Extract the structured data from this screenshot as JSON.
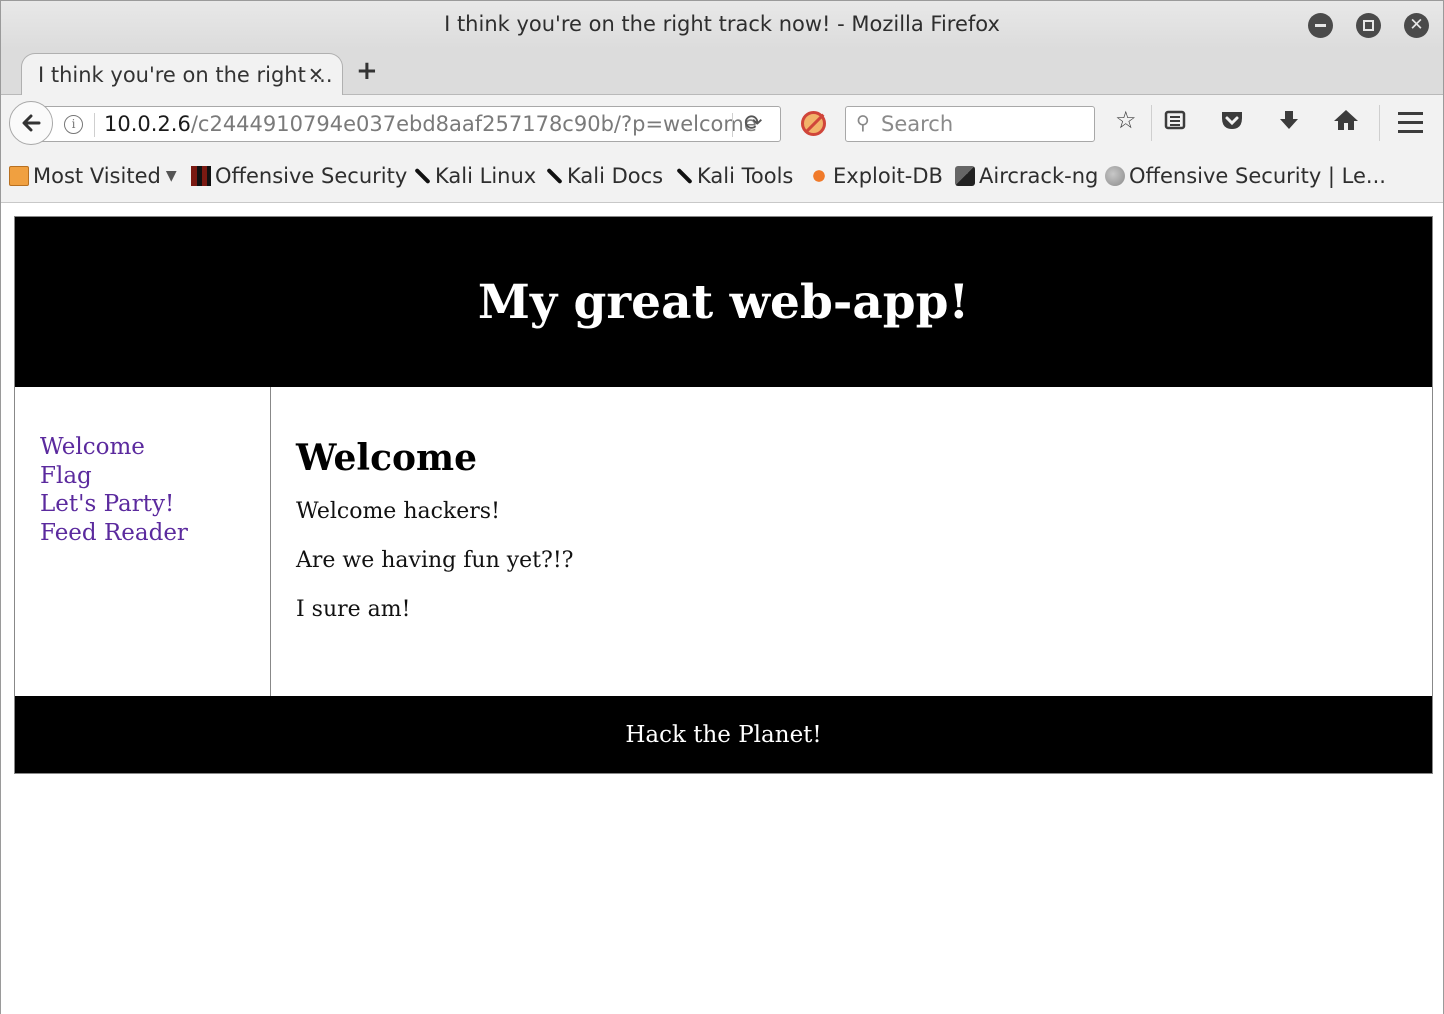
{
  "window": {
    "title": "I think you're on the right track now! - Mozilla Firefox"
  },
  "tabs": [
    {
      "title": "I think you're on the right ...",
      "active": true
    }
  ],
  "navbar": {
    "url_host": "10.0.2.6",
    "url_path": "/c2444910794e037ebd8aaf257178c90b/?p=welcome",
    "search_placeholder": "Search"
  },
  "bookmarks": [
    {
      "label": "Most Visited",
      "icon": "folder-icon",
      "dropdown": true
    },
    {
      "label": "Offensive Security",
      "icon": "offsec-icon"
    },
    {
      "label": "Kali Linux",
      "icon": "kali-dragon-icon"
    },
    {
      "label": "Kali Docs",
      "icon": "kali-dragon-icon"
    },
    {
      "label": "Kali Tools",
      "icon": "kali-dragon-icon"
    },
    {
      "label": "Exploit-DB",
      "icon": "exploit-db-icon"
    },
    {
      "label": "Aircrack-ng",
      "icon": "aircrack-icon"
    },
    {
      "label": "Offensive Security | Le...",
      "icon": "globe-icon"
    }
  ],
  "site": {
    "title": "My great web-app!",
    "nav": [
      {
        "label": "Welcome"
      },
      {
        "label": "Flag"
      },
      {
        "label": "Let's Party!"
      },
      {
        "label": "Feed Reader"
      }
    ],
    "heading": "Welcome",
    "paragraphs": [
      "Welcome hackers!",
      "Are we having fun yet?!?",
      "I sure am!"
    ],
    "footer": "Hack the Planet!",
    "link_color": "#5b2a9e",
    "header_bg": "#000000"
  }
}
